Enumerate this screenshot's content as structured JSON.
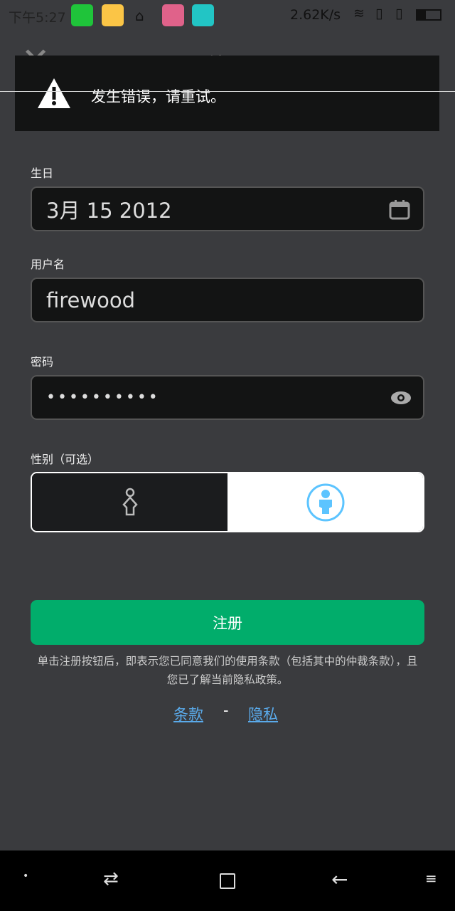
{
  "status_bar": {
    "time": "下午5:27",
    "speed": "2.62K/s"
  },
  "header": {
    "title": "注册"
  },
  "toast": {
    "message": "发生错误，请重试。"
  },
  "form": {
    "birthday_label": "生日",
    "birthday_value": "3月 15 2012",
    "username_label": "用户名",
    "username_value": "firewood",
    "password_label": "密码",
    "password_value": "••••••••••",
    "gender_label": "性别（可选）",
    "gender_selected": "male"
  },
  "register_button": "注册",
  "terms_text": "单击注册按钮后，即表示您已同意我们的使用条款（包括其中的仲裁条款），且您已了解当前隐私政策。",
  "links": {
    "terms": "条款",
    "separator": "-",
    "privacy": "隐私"
  },
  "colors": {
    "accent": "#01ad6b",
    "link": "#5aaaea",
    "male_icon": "#5cc4ff"
  }
}
